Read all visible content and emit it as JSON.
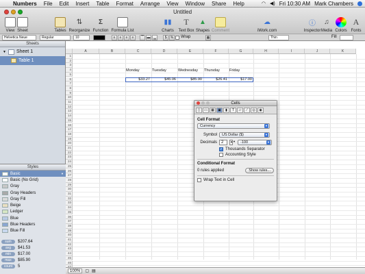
{
  "menubar": {
    "apple": "",
    "items": [
      "Numbers",
      "File",
      "Edit",
      "Insert",
      "Table",
      "Format",
      "Arrange",
      "View",
      "Window",
      "Share",
      "Help"
    ],
    "clock": "Fri 10:30 AM",
    "user": "Mark Chambers"
  },
  "window": {
    "title": "Untitled"
  },
  "toolbar": {
    "left": [
      "View",
      "Sheet",
      "Tables",
      "Reorganize",
      "Function",
      "Formula List"
    ],
    "middle": [
      "Charts",
      "Text Box",
      "Shapes",
      "Comment",
      "iWork.com"
    ],
    "right": [
      "Inspector",
      "Media",
      "Colors",
      "Fonts"
    ]
  },
  "formatbar": {
    "font": "Helvetica Neue",
    "style": "Regular",
    "size": "10",
    "wrap_label": "Wrap",
    "stroke": "Thin",
    "fill_label": "Fill"
  },
  "sidebar": {
    "sheets_header": "Sheets",
    "sheet": "Sheet 1",
    "table": "Table 1",
    "styles_header": "Styles",
    "styles": [
      "Basic",
      "Basic (No Grid)",
      "Gray",
      "Gray Headers",
      "Gray Fill",
      "Beige",
      "Ledger",
      "Blue",
      "Blue Headers",
      "Blue Fill"
    ],
    "style_colors": [
      "#ffffff",
      "#ffffff",
      "#c8c8c8",
      "#a9a9a9",
      "#d9d9d9",
      "#eadfc2",
      "#d6e6c4",
      "#b9cbe6",
      "#8aa6d2",
      "#c9d8ef"
    ],
    "stats": [
      {
        "tag": "sum",
        "value": "$207.64"
      },
      {
        "tag": "avg",
        "value": "$41.53"
      },
      {
        "tag": "min",
        "value": "$17.00"
      },
      {
        "tag": "max",
        "value": "$85.90"
      },
      {
        "tag": "count",
        "value": "5"
      }
    ]
  },
  "sheet": {
    "columns": [
      "A",
      "B",
      "C",
      "D",
      "E",
      "F",
      "G",
      "H",
      "I",
      "J",
      "K"
    ],
    "row_count": 48,
    "days": [
      "Monday",
      "Tuesday",
      "Wednesday",
      "Thursday",
      "Friday"
    ],
    "values": [
      "$33.27",
      "$45.06",
      "$85.90",
      "$26.41",
      "$17.00"
    ]
  },
  "status": {
    "zoom": "100%"
  },
  "inspector": {
    "title": "Cells",
    "cell_format_label": "Cell Format",
    "format_value": "Currency",
    "symbol_label": "Symbol",
    "symbol_value": "US Dollar ($)",
    "decimals_label": "Decimals",
    "decimals_value": "2",
    "negative_value": "-100",
    "thousands_label": "Thousands Separator",
    "accounting_label": "Accounting Style",
    "conditional_label": "Conditional Format",
    "rules_text": "0 rules applied",
    "show_rules": "Show rules...",
    "wrap_label": "Wrap Text in Cell"
  },
  "colors": {
    "accent": "#3a62c0",
    "selection": "#6f8fbf"
  }
}
